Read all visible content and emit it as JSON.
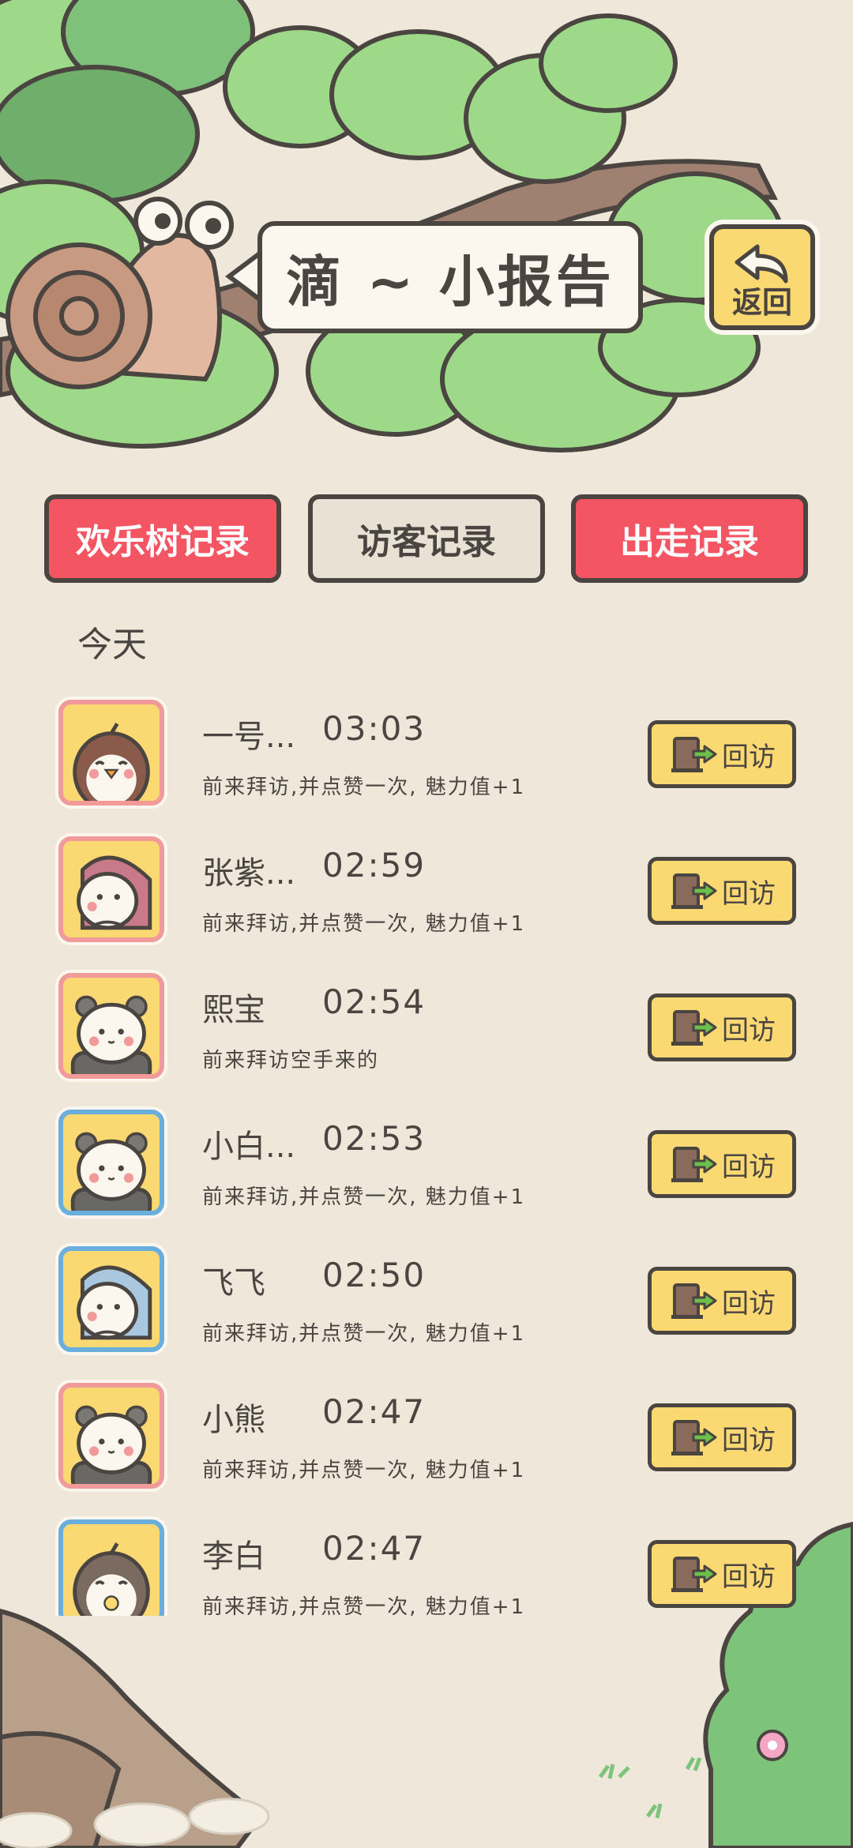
{
  "header": {
    "title": "滴 ~ 小报告",
    "back_label": "返回"
  },
  "tabs": [
    {
      "label": "欢乐树记录",
      "style": "red"
    },
    {
      "label": "访客记录",
      "style": "neutral",
      "selected": true
    },
    {
      "label": "出走记录",
      "style": "red"
    }
  ],
  "section": {
    "title": "今天"
  },
  "revisit_label": "回访",
  "visitors": [
    {
      "name": "一号...",
      "time": "03:03",
      "message": "前来拜访,并点赞一次, 魅力值+1",
      "avatar": "penguin-icon",
      "frame": "pink"
    },
    {
      "name": "张紫...",
      "time": "02:59",
      "message": "前来拜访,并点赞一次, 魅力值+1",
      "avatar": "hedgehog-icon",
      "frame": "pink"
    },
    {
      "name": "熙宝",
      "time": "02:54",
      "message": "前来拜访空手来的",
      "avatar": "panda-icon",
      "frame": "pink"
    },
    {
      "name": "小白...",
      "time": "02:53",
      "message": "前来拜访,并点赞一次, 魅力值+1",
      "avatar": "panda-icon",
      "frame": "blue"
    },
    {
      "name": "飞飞",
      "time": "02:50",
      "message": "前来拜访,并点赞一次, 魅力值+1",
      "avatar": "hedgehog-blue-icon",
      "frame": "blue"
    },
    {
      "name": "小熊",
      "time": "02:47",
      "message": "前来拜访,并点赞一次, 魅力值+1",
      "avatar": "panda-icon",
      "frame": "pink"
    },
    {
      "name": "李白",
      "time": "02:47",
      "message": "前来拜访,并点赞一次, 魅力值+1",
      "avatar": "penguin-pacifier-icon",
      "frame": "blue"
    }
  ],
  "colors": {
    "background": "#efe8da",
    "tab_red": "#f45563",
    "button_yellow": "#fbd972",
    "outline": "#4a4540",
    "leaf": "#9ed98a",
    "bush": "#7dc47a"
  }
}
